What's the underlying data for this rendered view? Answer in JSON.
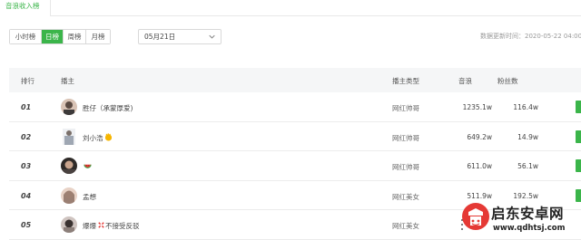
{
  "tabs": {
    "active_label": "音浪收入榜"
  },
  "filters": {
    "periods": [
      "小时榜",
      "日榜",
      "周榜",
      "月榜"
    ],
    "active_period": "日榜",
    "date_value": "05月21日"
  },
  "update_time": "数据更新时间：2020-05-22 04:00",
  "table": {
    "headers": {
      "rank": "排行",
      "host": "播主",
      "type": "播主类型",
      "voice": "音浪",
      "fans": "粉丝数"
    },
    "rows": [
      {
        "rank": "01",
        "name": "胜仔（承蒙厚爱)",
        "type": "网红帅哥",
        "voice": "1235.1w",
        "fans": "116.4w"
      },
      {
        "rank": "02",
        "name": "刘小浩",
        "type": "网红帅哥",
        "voice": "649.2w",
        "fans": "14.9w"
      },
      {
        "rank": "03",
        "name": "",
        "type": "网红帅哥",
        "voice": "611.0w",
        "fans": "56.1w"
      },
      {
        "rank": "04",
        "name": "孟想",
        "type": "网红美女",
        "voice": "511.9w",
        "fans": "192.5w"
      },
      {
        "rank": "05",
        "name": "爆爆",
        "name_suffix": "不接受反驳",
        "type": "网红美女",
        "voice": "",
        "fans": ""
      }
    ]
  },
  "watermark": {
    "title": "启东安卓网",
    "url": "www.qdhtsj.com"
  },
  "colors": {
    "accent": "#3bb54a",
    "watermark_red": "#e53935"
  }
}
